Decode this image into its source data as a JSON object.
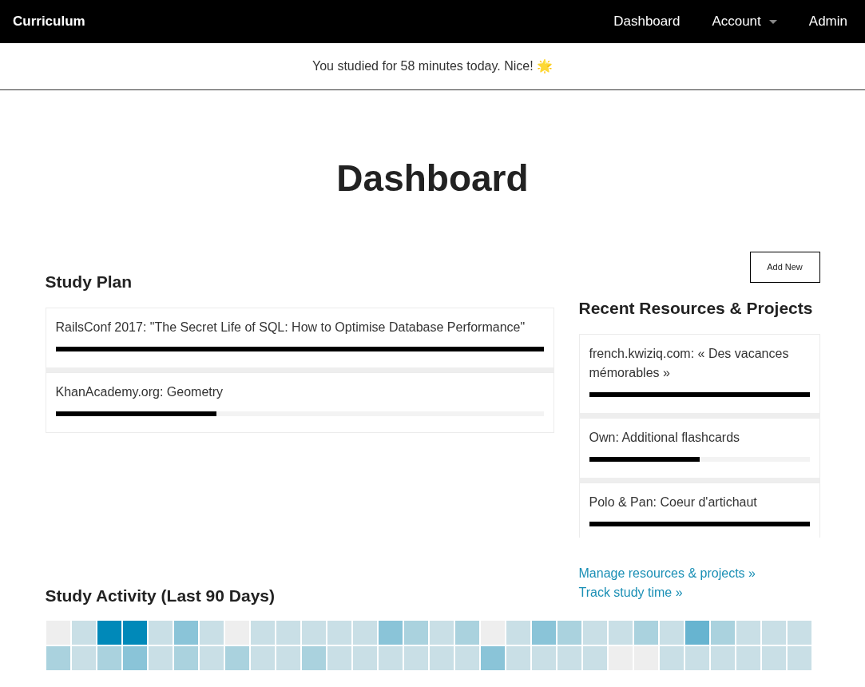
{
  "navbar": {
    "brand": "Curriculum",
    "links": [
      {
        "label": "Dashboard",
        "dropdown": false
      },
      {
        "label": "Account",
        "dropdown": true
      },
      {
        "label": "Admin",
        "dropdown": false
      }
    ]
  },
  "notice": "You studied for 58 minutes today. Nice! 🌟",
  "title": "Dashboard",
  "study_plan": {
    "heading": "Study Plan",
    "items": [
      {
        "name": "RailsConf 2017: \"The Secret Life of SQL: How to Optimise Database Performance\"",
        "level": 1
      },
      {
        "name": "KhanAcademy.org: Geometry",
        "level": 0.33
      }
    ]
  },
  "recent": {
    "button": "Add New",
    "heading": "Recent Resources & Projects",
    "items": [
      {
        "name": "french.kwiziq.com: « Des vacances mémorables »",
        "level": 1
      },
      {
        "name": "Own: Additional flashcards",
        "level": 0.5
      },
      {
        "name": "Polo & Pan: Coeur d'artichaut",
        "level": 1
      }
    ],
    "links": [
      "Manage resources & projects »",
      "Track study time »"
    ]
  },
  "activity": {
    "heading": "Study Activity (Last 90 Days)",
    "rows": [
      [
        {
          "color": "#eeeeee"
        },
        {
          "color": "#c9dfe6"
        },
        {
          "color": "#0089b9"
        },
        {
          "color": "#0089b9"
        },
        {
          "color": "#c9dfe6"
        },
        {
          "color": "#8ac4d8"
        },
        {
          "color": "#c9dfe6"
        },
        {
          "color": "#eeeeee"
        },
        {
          "color": "#c9dfe6"
        },
        {
          "color": "#c9dfe6"
        },
        {
          "color": "#c9dfe6"
        },
        {
          "color": "#c9dfe6"
        },
        {
          "color": "#c9dfe6"
        },
        {
          "color": "#8ac4d8"
        },
        {
          "color": "#aad2de"
        },
        {
          "color": "#c9dfe6"
        },
        {
          "color": "#aad2de"
        },
        {
          "color": "#eeeeee"
        },
        {
          "color": "#c9dfe6"
        },
        {
          "color": "#8ac4d8"
        },
        {
          "color": "#aad2de"
        },
        {
          "color": "#c9dfe6"
        },
        {
          "color": "#c9dfe6"
        },
        {
          "color": "#aad2de"
        },
        {
          "color": "#c9dfe6"
        },
        {
          "color": "#67b4d0"
        },
        {
          "color": "#aad2de"
        },
        {
          "color": "#c9dfe6"
        },
        {
          "color": "#c9dfe6"
        },
        {
          "color": "#c9dfe6"
        }
      ],
      [
        {
          "color": "#aad2de"
        },
        {
          "color": "#c9dfe6"
        },
        {
          "color": "#aad2de"
        },
        {
          "color": "#8ac4d8"
        },
        {
          "color": "#c9dfe6"
        },
        {
          "color": "#aad2de"
        },
        {
          "color": "#c9dfe6"
        },
        {
          "color": "#aad2de"
        },
        {
          "color": "#c9dfe6"
        },
        {
          "color": "#c9dfe6"
        },
        {
          "color": "#aad2de"
        },
        {
          "color": "#c9dfe6"
        },
        {
          "color": "#c9dfe6"
        },
        {
          "color": "#c9dfe6"
        },
        {
          "color": "#c9dfe6"
        },
        {
          "color": "#c9dfe6"
        },
        {
          "color": "#c9dfe6"
        },
        {
          "color": "#8ac4d8"
        },
        {
          "color": "#c9dfe6"
        },
        {
          "color": "#c9dfe6"
        },
        {
          "color": "#c9dfe6"
        },
        {
          "color": "#c9dfe6"
        },
        {
          "color": "#eeeeee"
        },
        {
          "color": "#eeeeee"
        },
        {
          "color": "#c9dfe6"
        },
        {
          "color": "#c9dfe6"
        },
        {
          "color": "#c9dfe6"
        },
        {
          "color": "#c9dfe6"
        },
        {
          "color": "#c9dfe6"
        },
        {
          "color": "#c9dfe6"
        }
      ]
    ]
  }
}
